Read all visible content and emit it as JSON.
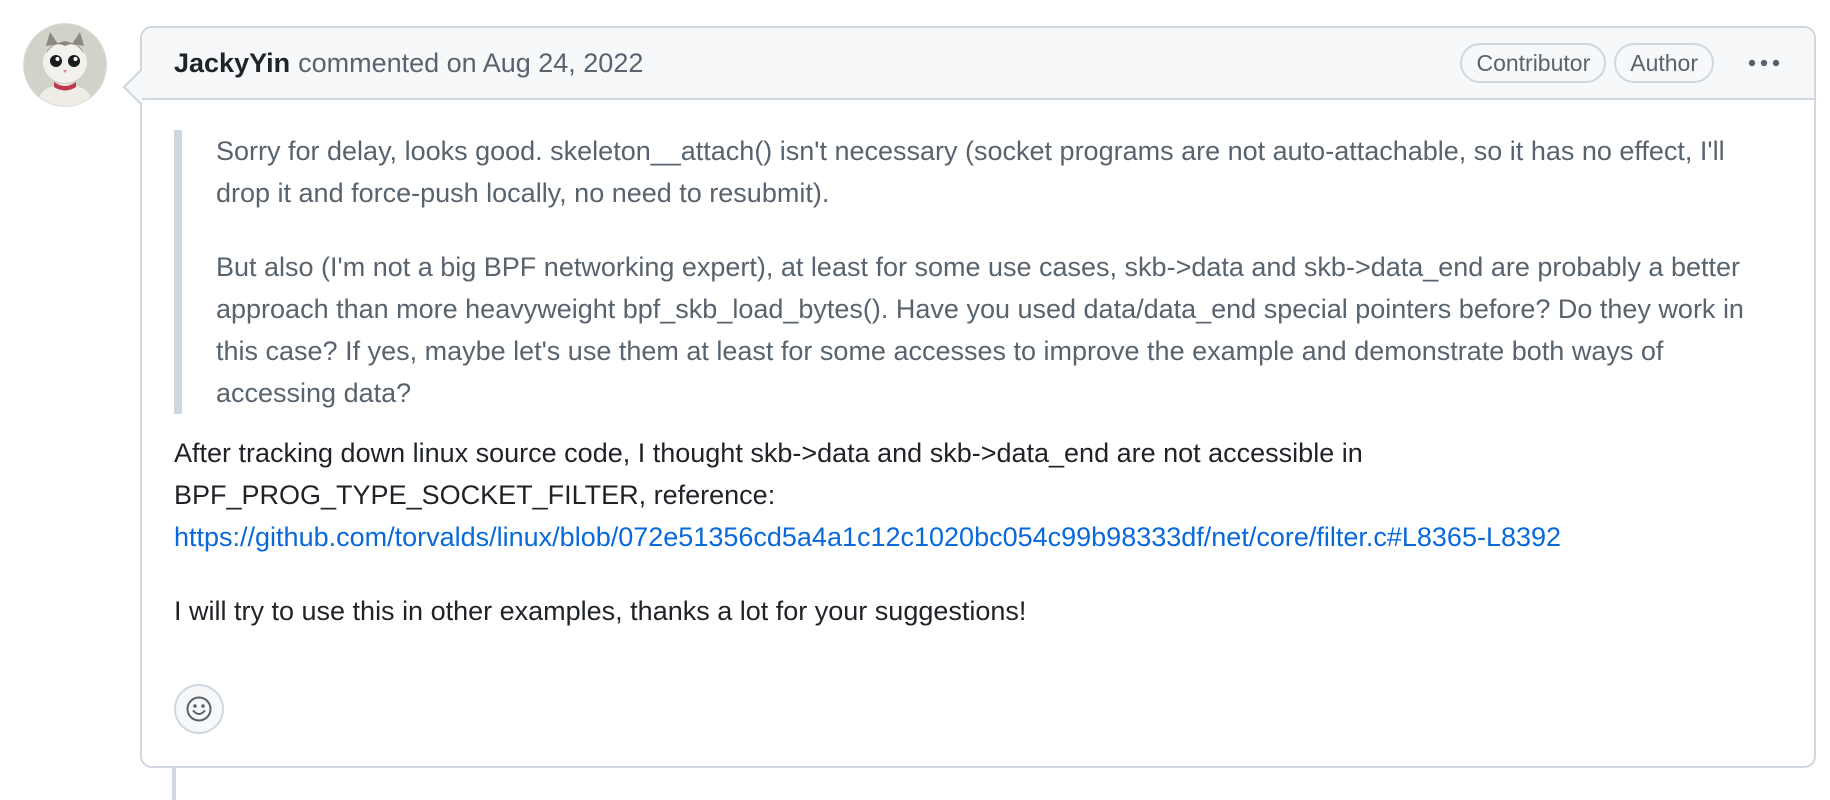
{
  "comment": {
    "author": "JackyYin",
    "action_text": "commented on Aug 24, 2022",
    "badges": [
      "Contributor",
      "Author"
    ],
    "more_options_icon": "kebab-horizontal-icon",
    "quote": {
      "paragraphs": [
        "Sorry for delay, looks good. skeleton__attach() isn't necessary (socket programs are not auto-attachable, so it has no effect, I'll drop it and force-push locally, no need to resubmit).",
        "But also (I'm not a big BPF networking expert), at least for some use cases, skb->data and skb->data_end are probably a better approach than more heavyweight bpf_skb_load_bytes(). Have you used data/data_end special pointers before? Do they work in this case? If yes, maybe let's use them at least for some accesses to improve the example and demonstrate both ways of accessing data?"
      ]
    },
    "reply": {
      "line1": "After tracking down linux source code, I thought skb->data and skb->data_end are not accessible in",
      "line2": "BPF_PROG_TYPE_SOCKET_FILTER, reference:",
      "link": "https://github.com/torvalds/linux/blob/072e51356cd5a4a1c12c1020bc054c99b98333df/net/core/filter.c#L8365-L8392",
      "closing": "I will try to use this in other examples, thanks a lot for your suggestions!"
    },
    "reaction_icon": "smiley-icon"
  },
  "colors": {
    "border": "#d0d7de",
    "header_bg": "#f6f8fa",
    "muted_text": "#59636e",
    "link": "#0969da"
  }
}
